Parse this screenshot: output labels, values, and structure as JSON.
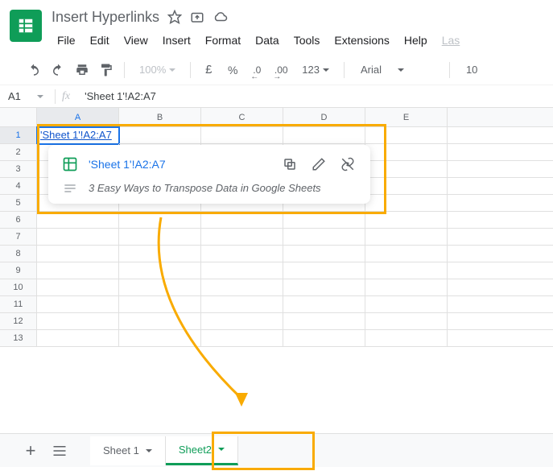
{
  "doc_title": "Insert Hyperlinks",
  "menus": [
    "File",
    "Edit",
    "View",
    "Insert",
    "Format",
    "Data",
    "Tools",
    "Extensions",
    "Help"
  ],
  "menu_last": "Las",
  "toolbar": {
    "zoom": "100%",
    "currency": "£",
    "percent": "%",
    "dec_dec": ".0",
    "inc_dec": ".00",
    "numfmt": "123",
    "font": "Arial",
    "size": "10"
  },
  "name_box": "A1",
  "fx": "fx",
  "formula": "'Sheet 1'!A2:A7",
  "columns": [
    "A",
    "B",
    "C",
    "D",
    "E"
  ],
  "row_count": 13,
  "active_cell_text": "'Sheet 1'!A2:A7",
  "popup": {
    "link_text": "'Sheet 1'!A2:A7",
    "description": "3 Easy Ways to Transpose Data in Google Sheets"
  },
  "sheets": {
    "tab1": "Sheet 1",
    "tab2": "Sheet2"
  }
}
